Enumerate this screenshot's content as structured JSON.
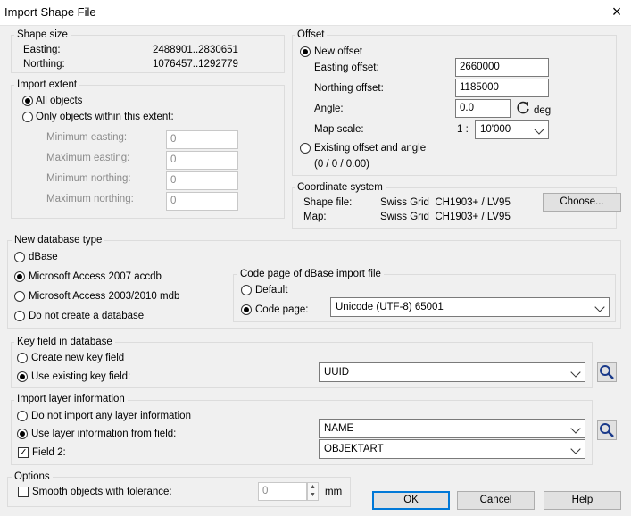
{
  "window": {
    "title": "Import Shape File",
    "close": "×"
  },
  "shape_size": {
    "legend": "Shape size",
    "easting_label": "Easting:",
    "easting_value": "2488901..2830651",
    "northing_label": "Northing:",
    "northing_value": "1076457..1292779"
  },
  "import_extent": {
    "legend": "Import extent",
    "all_objects": "All objects",
    "within_extent": "Only objects within this extent:",
    "min_easting_label": "Minimum easting:",
    "min_easting": "0",
    "max_easting_label": "Maximum easting:",
    "max_easting": "0",
    "min_northing_label": "Minimum northing:",
    "min_northing": "0",
    "max_northing_label": "Maximum northing:",
    "max_northing": "0"
  },
  "offset": {
    "legend": "Offset",
    "new_offset": "New offset",
    "easting_label": "Easting offset:",
    "easting_value": "2660000",
    "northing_label": "Northing offset:",
    "northing_value": "1185000",
    "angle_label": "Angle:",
    "angle_value": "0.0",
    "angle_unit": "deg",
    "map_scale_label": "Map scale:",
    "map_scale_prefix": "1 :",
    "map_scale_value": "10'000",
    "existing": "Existing offset and angle",
    "existing_values": "(0 / 0 / 0.00)"
  },
  "coordinate_system": {
    "legend": "Coordinate system",
    "shape_label": "Shape file:",
    "shape_value": "Swiss Grid  CH1903+ / LV95",
    "map_label": "Map:",
    "map_value": "Swiss Grid  CH1903+ / LV95",
    "choose": "Choose..."
  },
  "database": {
    "legend": "New database type",
    "options": [
      "dBase",
      "Microsoft Access 2007 accdb",
      "Microsoft Access 2003/2010 mdb",
      "Do not create a database"
    ],
    "selected": 1,
    "codepage_legend": "Code page of dBase import file",
    "default_label": "Default",
    "codepage_label": "Code page:",
    "codepage_value": "Unicode (UTF-8) 65001"
  },
  "key_field": {
    "legend": "Key field in database",
    "create": "Create new key field",
    "use_existing": "Use existing key field:",
    "value": "UUID"
  },
  "layer_info": {
    "legend": "Import layer information",
    "no_import": "Do not import any layer information",
    "use_field": "Use layer information from field:",
    "field_value": "NAME",
    "field2_label": "Field 2:",
    "field2_value": "OBJEKTART"
  },
  "options": {
    "legend": "Options",
    "smooth": "Smooth objects with tolerance:",
    "tolerance": "0",
    "unit": "mm"
  },
  "buttons": {
    "ok": "OK",
    "cancel": "Cancel",
    "help": "Help"
  }
}
